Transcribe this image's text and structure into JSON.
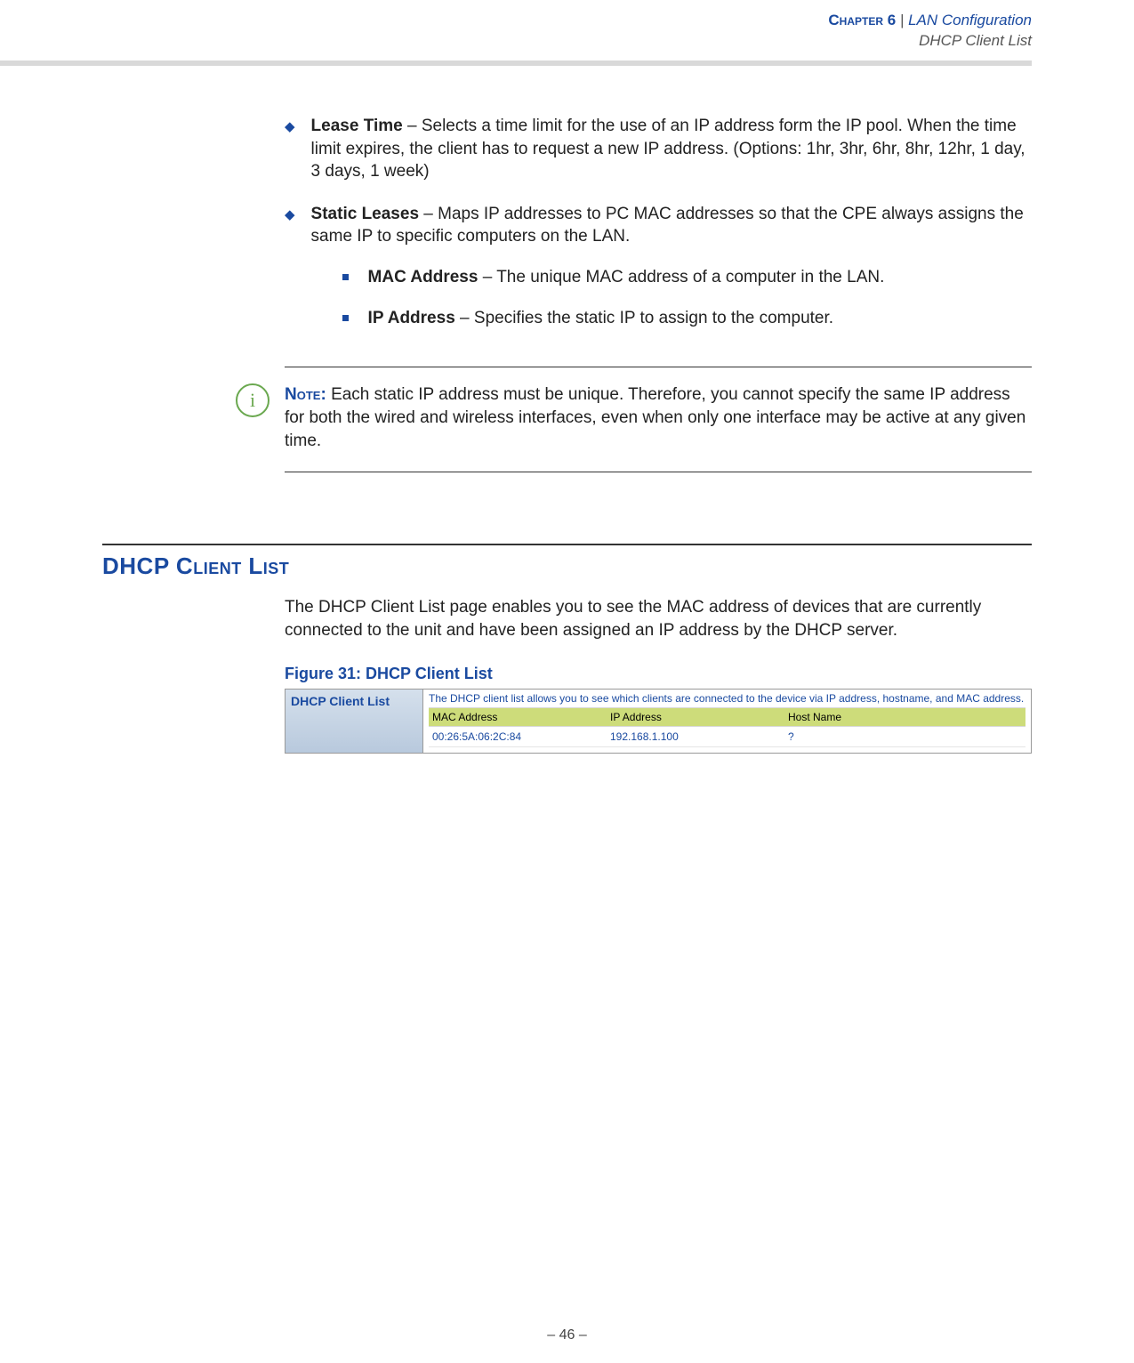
{
  "header": {
    "chapter_label": "Chapter 6",
    "separator": "|",
    "chapter_title": "LAN Configuration",
    "subtitle": "DHCP Client List"
  },
  "bullets": {
    "lease_time": {
      "term": "Lease Time",
      "desc": " – Selects a time limit for the use of an IP address form the IP pool. When the time limit expires, the client has to request a new IP address. (Options: 1hr, 3hr, 6hr, 8hr, 12hr, 1 day, 3 days, 1 week)"
    },
    "static_leases": {
      "term": "Static Leases",
      "desc": " – Maps IP addresses to PC MAC addresses so that the CPE always assigns the same IP to specific computers on the LAN."
    },
    "mac_address": {
      "term": "MAC Address",
      "desc": " – The unique MAC address of a computer in the LAN."
    },
    "ip_address": {
      "term": "IP Address",
      "desc": " – Specifies the static IP to assign to the computer."
    }
  },
  "note": {
    "icon_char": "i",
    "label": "Note: ",
    "text": "Each static IP address must be unique. Therefore, you cannot specify the same IP address for both the wired and wireless interfaces, even when only one interface may be active at any given time."
  },
  "section": {
    "heading": "DHCP Client List",
    "intro": "The DHCP Client List page enables you to see the MAC address of devices that are currently connected to the unit and have been assigned an IP address by the DHCP server."
  },
  "figure": {
    "caption": "Figure 31:  DHCP Client List",
    "side_title": "DHCP Client List",
    "description": "The DHCP client list allows you to see which clients are connected to the device via IP address, hostname, and MAC address.",
    "columns": {
      "c1": "MAC Address",
      "c2": "IP Address",
      "c3": "Host Name"
    },
    "row": {
      "c1": "00:26:5A:06:2C:84",
      "c2": "192.168.1.100",
      "c3": "?"
    }
  },
  "page_number": "–  46  –"
}
